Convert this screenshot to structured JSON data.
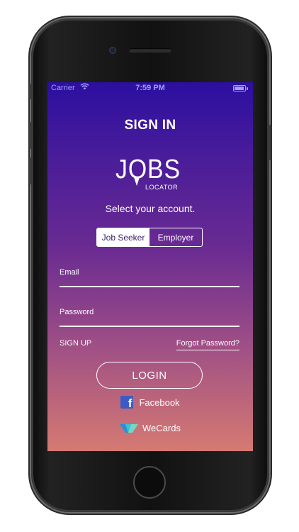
{
  "status_bar": {
    "carrier": "Carrier",
    "time": "7:59 PM",
    "wifi_icon": "wifi-icon",
    "battery_icon": "battery-icon"
  },
  "header": {
    "title": "SIGN IN"
  },
  "logo": {
    "wordmark": "JOBS",
    "tagline": "LOCATOR"
  },
  "account_prompt": "Select your account.",
  "account_type": {
    "options": [
      "Job Seeker",
      "Employer"
    ],
    "selected": "Job Seeker"
  },
  "form": {
    "email_label": "Email",
    "email_value": "",
    "password_label": "Password",
    "password_value": ""
  },
  "links": {
    "signup": "SIGN UP",
    "forgot_password": "Forgot Password?"
  },
  "login_button": "LOGIN",
  "social": {
    "facebook_label": "Facebook",
    "facebook_icon": "facebook-icon",
    "wecards_label": "WeCards",
    "wecards_icon": "wecards-icon"
  },
  "colors": {
    "gradient_top": "#2c0fa0",
    "gradient_bottom": "#d57a72",
    "facebook_blue": "#3b5cc4",
    "wecards_teal": "#39c3d6"
  }
}
